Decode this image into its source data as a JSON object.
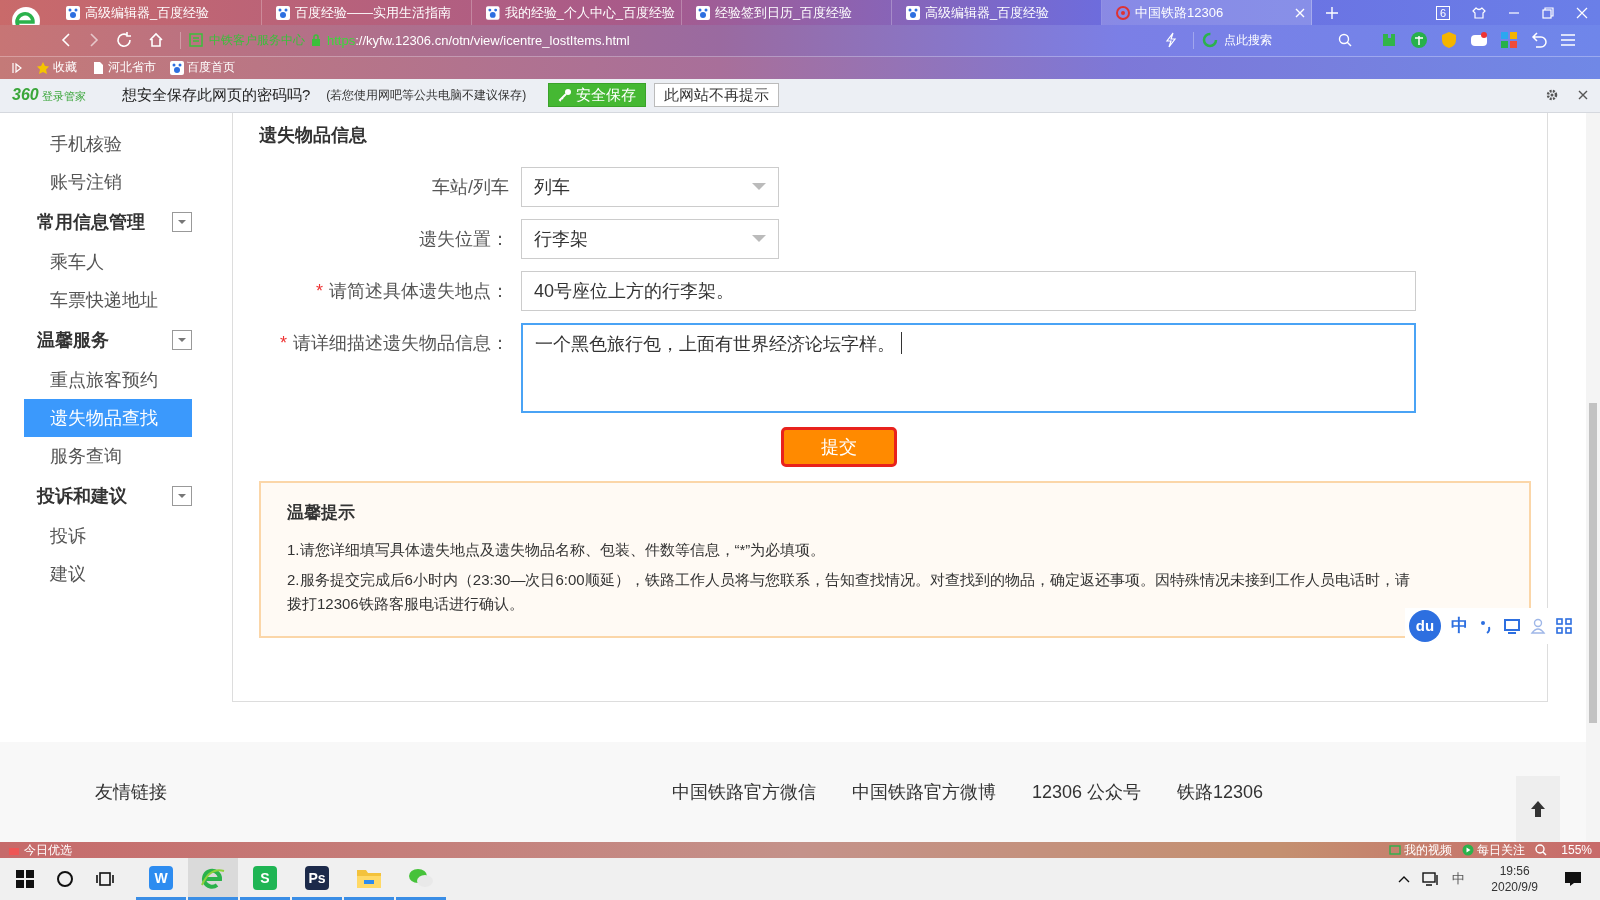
{
  "browser": {
    "tabs": [
      {
        "title": "高级编辑器_百度经验",
        "selected": false
      },
      {
        "title": "百度经验——实用生活指南",
        "selected": false
      },
      {
        "title": "我的经验_个人中心_百度经验",
        "selected": false
      },
      {
        "title": "经验签到日历_百度经验",
        "selected": false
      },
      {
        "title": "高级编辑器_百度经验",
        "selected": false
      },
      {
        "title": "中国铁路12306",
        "selected": true
      }
    ],
    "tab_count": "6",
    "address": {
      "site_badge": "中铁客户服务中心",
      "url_scheme": "https",
      "url_rest": "://kyfw.12306.cn/otn/view/icentre_lostItems.html",
      "search": "点此搜索"
    },
    "bookmarks": [
      "收藏",
      "河北省市",
      "百度首页"
    ]
  },
  "password_bar": {
    "brand": "360",
    "brand_sub": "登录管家",
    "question": "想安全保存此网页的密码吗?",
    "hint": "(若您使用网吧等公共电脑不建议保存)",
    "buttons": [
      {
        "label": "安全保存",
        "kind": "primary"
      },
      {
        "label": "此网站不再提示",
        "kind": "plain"
      }
    ]
  },
  "sidebar": {
    "sections": [
      {
        "items": [
          {
            "label": "手机核验",
            "selected": false
          },
          {
            "label": "账号注销",
            "selected": false
          }
        ]
      },
      {
        "title": "常用信息管理",
        "items": [
          {
            "label": "乘车人",
            "selected": false
          },
          {
            "label": "车票快递地址",
            "selected": false
          }
        ]
      },
      {
        "title": "温馨服务",
        "items": [
          {
            "label": "重点旅客预约",
            "selected": false
          },
          {
            "label": "遗失物品查找",
            "selected": true
          },
          {
            "label": "服务查询",
            "selected": false
          }
        ]
      },
      {
        "title": "投诉和建议",
        "items": [
          {
            "label": "投诉",
            "selected": false
          },
          {
            "label": "建议",
            "selected": false
          }
        ]
      }
    ]
  },
  "form": {
    "title": "遗失物品信息",
    "fields": [
      {
        "kind": "select",
        "label": "车站/列车",
        "value": "列车"
      },
      {
        "kind": "select",
        "label": "遗失位置：",
        "value": "行李架"
      },
      {
        "kind": "input",
        "required_mark": "*",
        "label": "请简述具体遗失地点：",
        "value": "40号座位上方的行李架。"
      },
      {
        "kind": "textarea",
        "required_mark": "*",
        "label": "请详细描述遗失物品信息：",
        "value": "一个黑色旅行包，上面有世界经济论坛字样。"
      }
    ],
    "submit": "提交"
  },
  "notice": {
    "title": "温馨提示",
    "lines": [
      "1.请您详细填写具体遗失地点及遗失物品名称、包装、件数等信息，“*”为必填项。",
      "2.服务提交完成后6小时内（23:30—次日6:00顺延），铁路工作人员将与您联系，告知查找情况。对查找到的物品，确定返还事项。因特殊情况未接到工作人员电话时，请拨打12306铁路客服电话进行确认。"
    ]
  },
  "ime_toolbar": {
    "logo": "du",
    "mode": "中"
  },
  "footer": {
    "title": "友情链接",
    "links": [
      "中国铁路官方微信",
      "中国铁路官方微博",
      "12306 公众号",
      "铁路12306"
    ]
  },
  "status_bar": {
    "left": "今日优选",
    "items": [
      "我的视频",
      "每日关注"
    ],
    "zoom": "155%"
  },
  "taskbar": {
    "apps": [
      {
        "kind": "letter",
        "glyph": "W",
        "color": "#2d8cf0",
        "selected": false
      },
      {
        "kind": "browser",
        "selected": true
      },
      {
        "kind": "letter",
        "glyph": "S",
        "color": "#1fb554",
        "selected": false
      },
      {
        "kind": "letter",
        "glyph": "Ps",
        "color": "#1c2a4a",
        "selected": false
      },
      {
        "kind": "folder",
        "selected": false
      },
      {
        "kind": "chat",
        "selected": false
      }
    ],
    "ime": "中",
    "time": "19:56",
    "date": "2020/9/9"
  }
}
